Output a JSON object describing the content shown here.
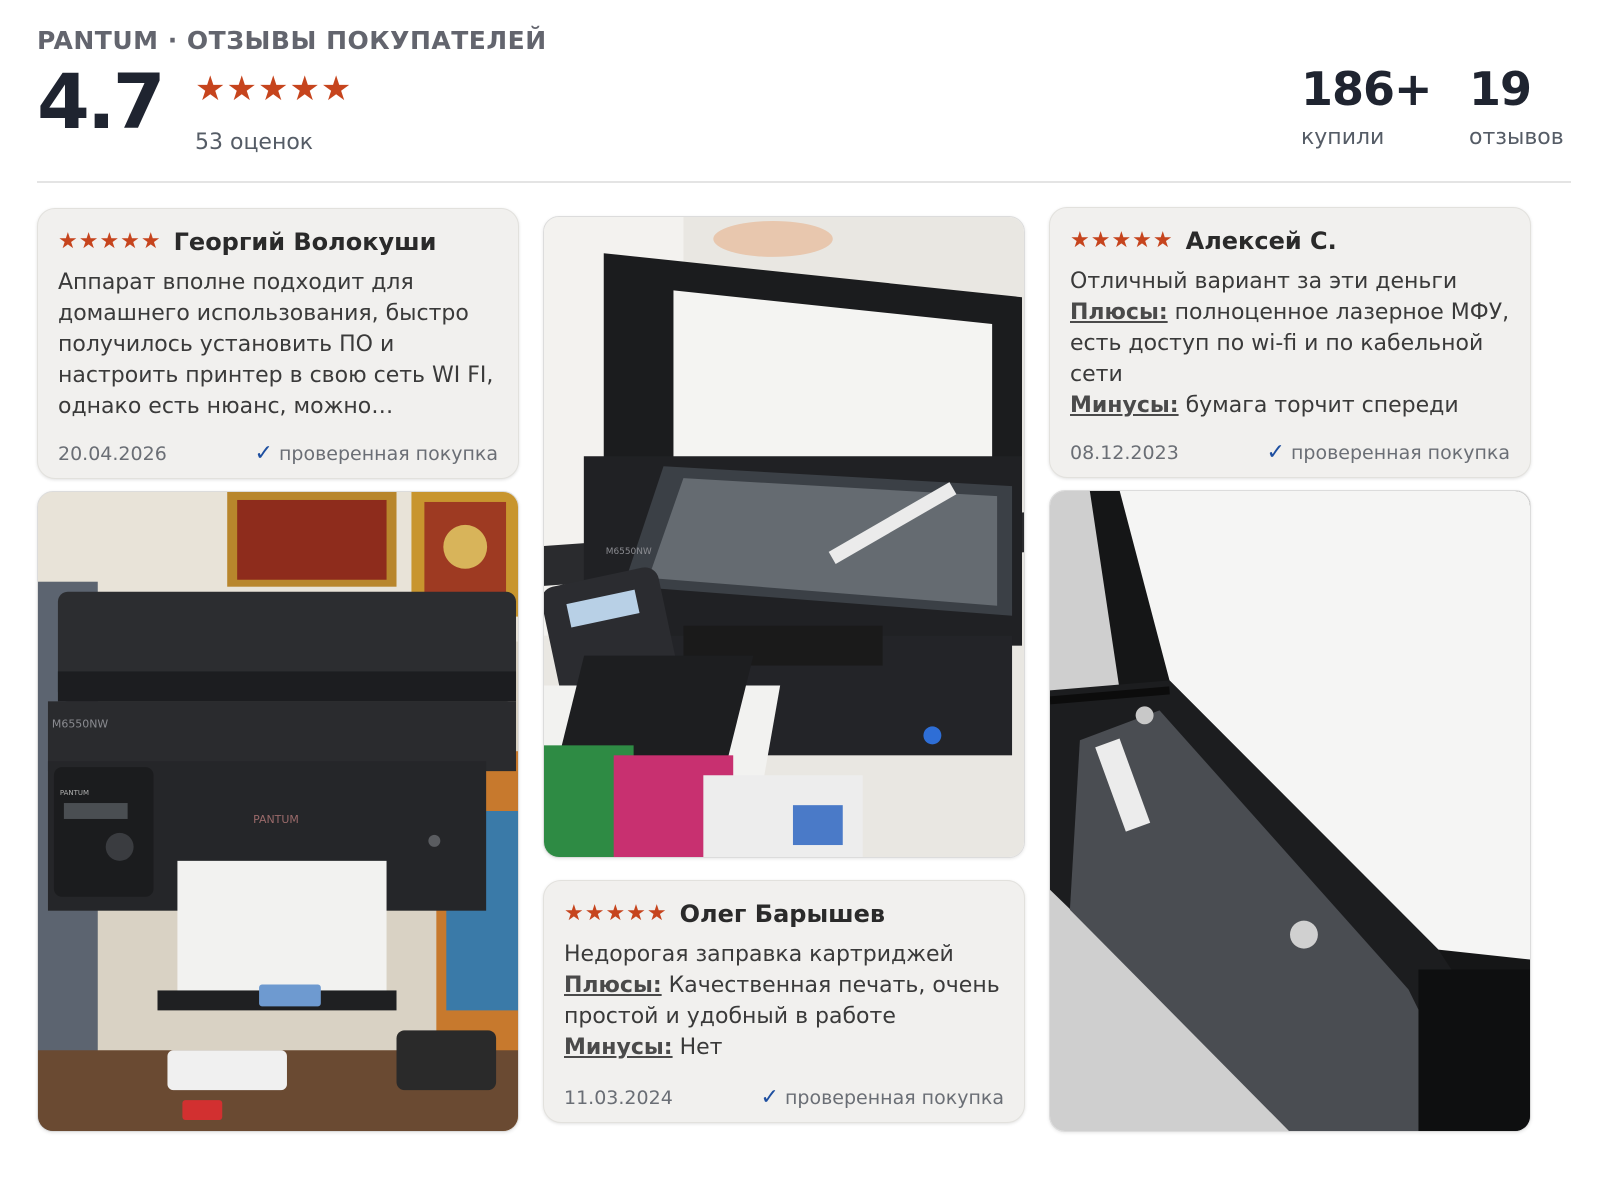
{
  "header": {
    "brand_line": "PANTUM · ОТЗЫВЫ ПОКУПАТЕЛЕЙ",
    "rating": "4.7",
    "rating_stars": 5,
    "ratings_count": "53 оценок",
    "bought_value": "186+",
    "bought_label": "купили",
    "reviews_value": "19",
    "reviews_label": "отзывов"
  },
  "reviews": [
    {
      "stars": 5,
      "author": "Георгий Волокуши",
      "text": "Аппарат вполне подходит для домашнего использования, быстро получилось установить ПО и настроить принтер в свою сеть WI FI, однако есть нюанс, можно подключи...",
      "date": "20.04.2026",
      "verified": "проверенная покупка"
    },
    {
      "stars": 5,
      "author": "Алексей С.",
      "text": "Отличный вариант за эти деньги",
      "pros_label": "Плюсы:",
      "pros": "полноценное лазерное МФУ, есть доступ по wi-fi и по кабельной сети",
      "cons_label": "Минусы:",
      "cons": "бумага торчит спереди",
      "date": "08.12.2023",
      "verified": "проверенная покупка"
    },
    {
      "stars": 5,
      "author": "Олег Барышев",
      "text": "Недорогая заправка картриджей",
      "pros_label": "Плюсы:",
      "pros": "Качественная печать, очень простой и удобный в работе",
      "cons_label": "Минусы:",
      "cons": "Нет",
      "date": "11.03.2024",
      "verified": "проверенная покупка"
    }
  ],
  "photos": {
    "printer_model": "M6550NW",
    "printer_brand": "PANTUM",
    "printer_brand_small": "PANTUM"
  },
  "colors": {
    "star": "#c6441d",
    "check": "#1e4fa0",
    "card_bg": "#f1f0ee"
  }
}
